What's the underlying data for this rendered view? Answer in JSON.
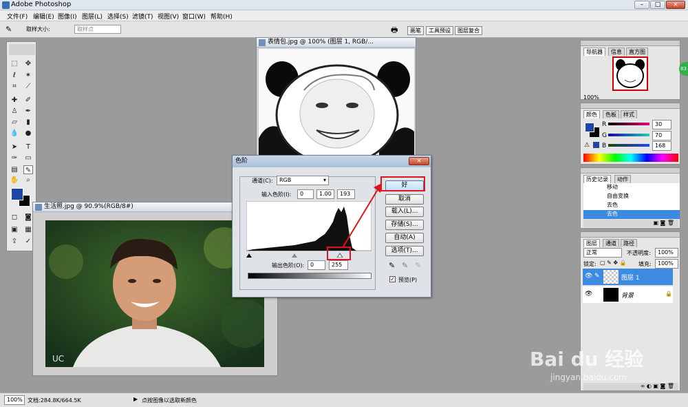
{
  "app": {
    "title": "Adobe Photoshop"
  },
  "window_controls": {
    "minimize": "–",
    "restore": "□",
    "close": "×"
  },
  "menu": [
    "文件(F)",
    "编辑(E)",
    "图像(I)",
    "图层(L)",
    "选择(S)",
    "滤镜(T)",
    "视图(V)",
    "窗口(W)",
    "帮助(H)"
  ],
  "options_bar": {
    "sample_label": "取样大小:",
    "sample_value": "取样点",
    "tab_brush": "画笔",
    "tab_tool_preset": "工具预设",
    "tab_layer_comp": "图层复合"
  },
  "doc_top": {
    "title": "表情包.jpg @ 100% (图层 1, RGB/..."
  },
  "doc_bottom": {
    "title": "生活照.jpg @ 90.9%(RGB/8#)",
    "watermark": "UC"
  },
  "levels": {
    "title": "色阶",
    "channel_label": "通道(C):",
    "channel_value": "RGB",
    "input_label": "输入色阶(I):",
    "input_black": "0",
    "input_gamma": "1.00",
    "input_white": "193",
    "output_label": "输出色阶(O):",
    "output_black": "0",
    "output_white": "255",
    "ok": "好",
    "cancel": "取消",
    "load": "载入(L)...",
    "save": "存储(S)...",
    "auto": "自动(A)",
    "options": "选项(T)...",
    "preview": "预览(P)"
  },
  "navigator": {
    "tabs": [
      "导航器",
      "信息",
      "直方图"
    ],
    "zoom": "100%"
  },
  "color_panel": {
    "tabs": [
      "颜色",
      "色板",
      "样式"
    ],
    "r_label": "R",
    "g_label": "G",
    "b_label": "B",
    "r": "30",
    "g": "70",
    "b": "168",
    "fg_color": "#1e46a8"
  },
  "history": {
    "tabs": [
      "历史记录",
      "动作"
    ],
    "items": [
      "移动",
      "自由变换",
      "去色",
      "去色"
    ]
  },
  "layers": {
    "tabs": [
      "图层",
      "通道",
      "路径"
    ],
    "blend": "正常",
    "opacity_label": "不透明度:",
    "opacity": "100%",
    "lock_label": "锁定:",
    "fill_label": "填充:",
    "fill": "100%",
    "items": [
      "图层 1",
      "背景"
    ]
  },
  "status": {
    "zoom": "100%",
    "doc_info": "文档:284.8K/664.5K",
    "hint": "点按图像以选取新颜色"
  },
  "watermark": {
    "brand": "Bai du 经验",
    "url": "jingyan.baidu.com"
  },
  "badge": "83"
}
